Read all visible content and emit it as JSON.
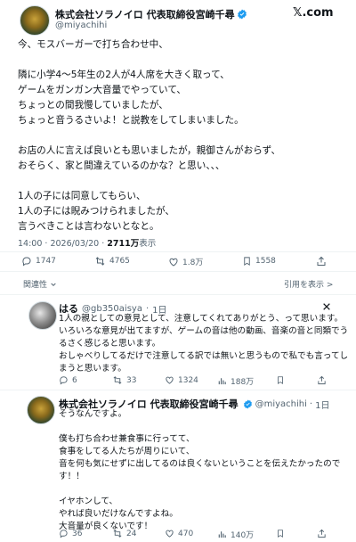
{
  "brand": {
    "logo_text": "𝕏.com"
  },
  "main_tweet": {
    "author_name": "株式会社ソラノイロ 代表取締役宮崎千尋",
    "author_handle": "@miyachihi",
    "body": "今、モスバーガーで打ち合わせ中、\n\n隣に小学4〜5年生の2人が4人席を大きく取って、\nゲームをガンガン大音量でやっていて、\nちょっとの間我慢していましたが、\nちょっと音うるさいよ！と説教をしてしまいました。\n\nお店の人に言えば良いとも思いましたが，親御さんがおらず、\nおそらく、家と間違えているのかな？と思い、、、\n\n1人の子には同意してもらい、\n1人の子には睨みつけられましたが、\n言うべきことは言わないとなと。",
    "time": "14:00",
    "date": "2026/03/20",
    "views": "2711万",
    "views_label": "表示",
    "replies": "1747",
    "retweets": "4765",
    "likes": "1.8万",
    "bookmarks": "1558"
  },
  "sort": {
    "relevance_label": "関連性",
    "quote_label": "引用を表示 >"
  },
  "reply1": {
    "author_name": "はる",
    "author_handle": "@gb350aisya",
    "time_ago": "1日",
    "body": "1人の親としての意見として、注意してくれてありがとう、って思います。\nいろいろな意見が出てますが、ゲームの音は他の動画、音楽の音と同類でう\nるさく感じると思います。\nおしゃべりしてるだけで注意してる訳では無いと思うもので私でも言ってし\nまうと思います。",
    "replies": "6",
    "retweets": "33",
    "likes": "1324",
    "views": "188万"
  },
  "reply2": {
    "author_name": "株式会社ソラノイロ 代表取締役宮崎千尋",
    "author_handle": "@miyachihi",
    "time_ago": "1日",
    "body": "そうなんですよ。\n\n僕も打ち合わせ兼食事に行ってて、\n食事をしてる人たちが周りにいて、\n音を何も気にせずに出してるのは良くないということを伝えたかったので\nす！！\n\nイヤホンして、\nやれば良いだけなんですよね。\n大音量が良くないです！",
    "replies": "36",
    "retweets": "24",
    "likes": "470",
    "views": "140万"
  },
  "colors": {
    "verified": "#1d9bf0",
    "text": "#0f1419",
    "muted": "#536471",
    "divider": "#eff3f4"
  },
  "icons": [
    "verified-badge-icon",
    "reply-icon",
    "retweet-icon",
    "like-icon",
    "bookmark-icon",
    "share-icon",
    "views-icon",
    "chevron-down-icon",
    "close-icon",
    "more-icon"
  ]
}
